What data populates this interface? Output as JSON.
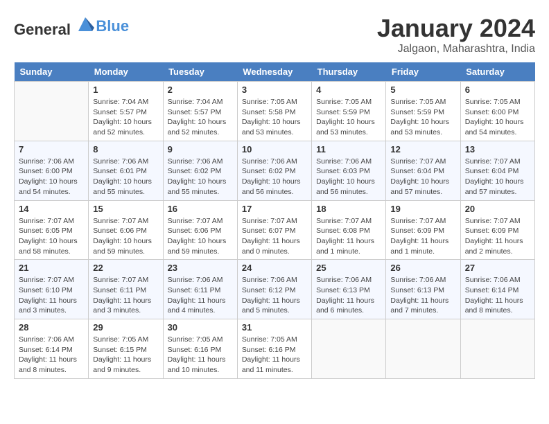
{
  "header": {
    "logo_general": "General",
    "logo_blue": "Blue",
    "month": "January 2024",
    "location": "Jalgaon, Maharashtra, India"
  },
  "days_of_week": [
    "Sunday",
    "Monday",
    "Tuesday",
    "Wednesday",
    "Thursday",
    "Friday",
    "Saturday"
  ],
  "weeks": [
    [
      {
        "day": "",
        "info": ""
      },
      {
        "day": "1",
        "info": "Sunrise: 7:04 AM\nSunset: 5:57 PM\nDaylight: 10 hours\nand 52 minutes."
      },
      {
        "day": "2",
        "info": "Sunrise: 7:04 AM\nSunset: 5:57 PM\nDaylight: 10 hours\nand 52 minutes."
      },
      {
        "day": "3",
        "info": "Sunrise: 7:05 AM\nSunset: 5:58 PM\nDaylight: 10 hours\nand 53 minutes."
      },
      {
        "day": "4",
        "info": "Sunrise: 7:05 AM\nSunset: 5:59 PM\nDaylight: 10 hours\nand 53 minutes."
      },
      {
        "day": "5",
        "info": "Sunrise: 7:05 AM\nSunset: 5:59 PM\nDaylight: 10 hours\nand 53 minutes."
      },
      {
        "day": "6",
        "info": "Sunrise: 7:05 AM\nSunset: 6:00 PM\nDaylight: 10 hours\nand 54 minutes."
      }
    ],
    [
      {
        "day": "7",
        "info": "Sunrise: 7:06 AM\nSunset: 6:00 PM\nDaylight: 10 hours\nand 54 minutes."
      },
      {
        "day": "8",
        "info": "Sunrise: 7:06 AM\nSunset: 6:01 PM\nDaylight: 10 hours\nand 55 minutes."
      },
      {
        "day": "9",
        "info": "Sunrise: 7:06 AM\nSunset: 6:02 PM\nDaylight: 10 hours\nand 55 minutes."
      },
      {
        "day": "10",
        "info": "Sunrise: 7:06 AM\nSunset: 6:02 PM\nDaylight: 10 hours\nand 56 minutes."
      },
      {
        "day": "11",
        "info": "Sunrise: 7:06 AM\nSunset: 6:03 PM\nDaylight: 10 hours\nand 56 minutes."
      },
      {
        "day": "12",
        "info": "Sunrise: 7:07 AM\nSunset: 6:04 PM\nDaylight: 10 hours\nand 57 minutes."
      },
      {
        "day": "13",
        "info": "Sunrise: 7:07 AM\nSunset: 6:04 PM\nDaylight: 10 hours\nand 57 minutes."
      }
    ],
    [
      {
        "day": "14",
        "info": "Sunrise: 7:07 AM\nSunset: 6:05 PM\nDaylight: 10 hours\nand 58 minutes."
      },
      {
        "day": "15",
        "info": "Sunrise: 7:07 AM\nSunset: 6:06 PM\nDaylight: 10 hours\nand 59 minutes."
      },
      {
        "day": "16",
        "info": "Sunrise: 7:07 AM\nSunset: 6:06 PM\nDaylight: 10 hours\nand 59 minutes."
      },
      {
        "day": "17",
        "info": "Sunrise: 7:07 AM\nSunset: 6:07 PM\nDaylight: 11 hours\nand 0 minutes."
      },
      {
        "day": "18",
        "info": "Sunrise: 7:07 AM\nSunset: 6:08 PM\nDaylight: 11 hours\nand 1 minute."
      },
      {
        "day": "19",
        "info": "Sunrise: 7:07 AM\nSunset: 6:09 PM\nDaylight: 11 hours\nand 1 minute."
      },
      {
        "day": "20",
        "info": "Sunrise: 7:07 AM\nSunset: 6:09 PM\nDaylight: 11 hours\nand 2 minutes."
      }
    ],
    [
      {
        "day": "21",
        "info": "Sunrise: 7:07 AM\nSunset: 6:10 PM\nDaylight: 11 hours\nand 3 minutes."
      },
      {
        "day": "22",
        "info": "Sunrise: 7:07 AM\nSunset: 6:11 PM\nDaylight: 11 hours\nand 3 minutes."
      },
      {
        "day": "23",
        "info": "Sunrise: 7:06 AM\nSunset: 6:11 PM\nDaylight: 11 hours\nand 4 minutes."
      },
      {
        "day": "24",
        "info": "Sunrise: 7:06 AM\nSunset: 6:12 PM\nDaylight: 11 hours\nand 5 minutes."
      },
      {
        "day": "25",
        "info": "Sunrise: 7:06 AM\nSunset: 6:13 PM\nDaylight: 11 hours\nand 6 minutes."
      },
      {
        "day": "26",
        "info": "Sunrise: 7:06 AM\nSunset: 6:13 PM\nDaylight: 11 hours\nand 7 minutes."
      },
      {
        "day": "27",
        "info": "Sunrise: 7:06 AM\nSunset: 6:14 PM\nDaylight: 11 hours\nand 8 minutes."
      }
    ],
    [
      {
        "day": "28",
        "info": "Sunrise: 7:06 AM\nSunset: 6:14 PM\nDaylight: 11 hours\nand 8 minutes."
      },
      {
        "day": "29",
        "info": "Sunrise: 7:05 AM\nSunset: 6:15 PM\nDaylight: 11 hours\nand 9 minutes."
      },
      {
        "day": "30",
        "info": "Sunrise: 7:05 AM\nSunset: 6:16 PM\nDaylight: 11 hours\nand 10 minutes."
      },
      {
        "day": "31",
        "info": "Sunrise: 7:05 AM\nSunset: 6:16 PM\nDaylight: 11 hours\nand 11 minutes."
      },
      {
        "day": "",
        "info": ""
      },
      {
        "day": "",
        "info": ""
      },
      {
        "day": "",
        "info": ""
      }
    ]
  ]
}
